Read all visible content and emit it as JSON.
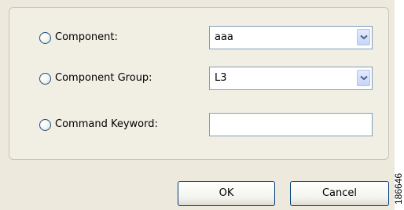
{
  "options": [
    {
      "label": "Component:",
      "control": "combo",
      "value": "aaa"
    },
    {
      "label": "Component Group:",
      "control": "combo",
      "value": "L3"
    },
    {
      "label": "Command Keyword:",
      "control": "text",
      "value": ""
    }
  ],
  "buttons": {
    "ok_label": "OK",
    "cancel_label": "Cancel"
  },
  "figure_number": "186646",
  "colors": {
    "dialog_background": "#ede9dc",
    "group_border": "#c9c4b3",
    "field_border": "#7f9db9",
    "button_border": "#003c74",
    "combo_arrow": "#4d6185"
  },
  "icons": {
    "combo_button": "chevron-down-icon"
  }
}
